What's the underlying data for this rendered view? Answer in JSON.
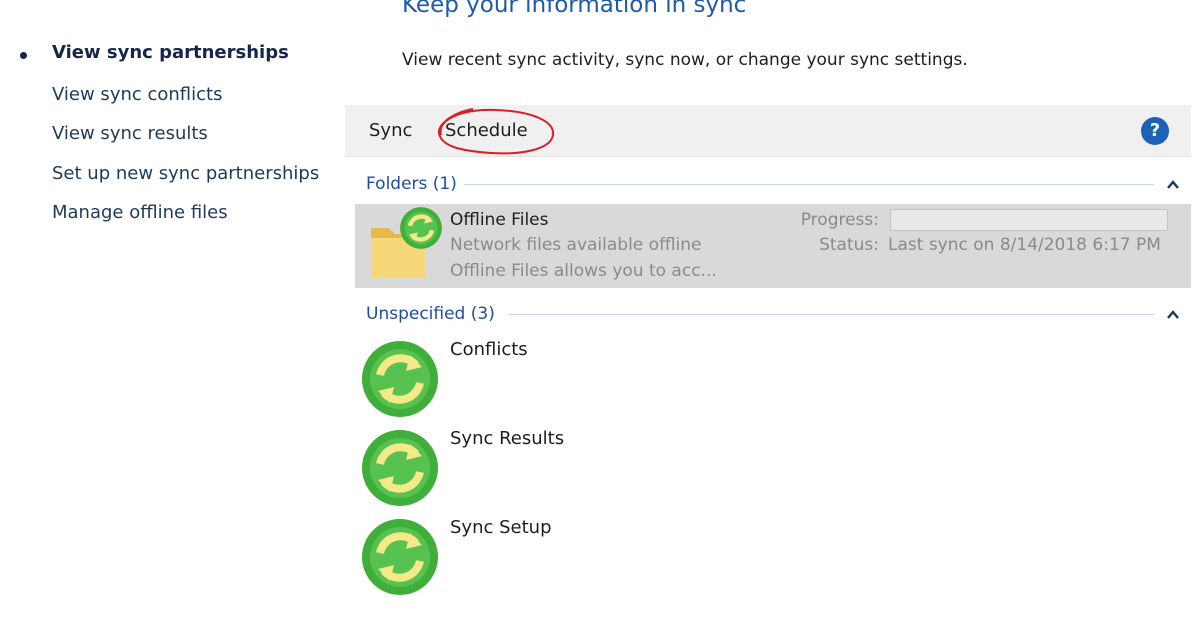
{
  "header": {
    "title": "Keep your information in sync",
    "description": "View recent sync activity, sync now, or change your sync settings."
  },
  "sidebar": {
    "items": [
      {
        "label": "View sync partnerships",
        "active": true
      },
      {
        "label": "View sync conflicts"
      },
      {
        "label": "View sync results"
      },
      {
        "label": "Set up new sync partnerships"
      },
      {
        "label": "Manage offline files"
      }
    ]
  },
  "toolbar": {
    "sync_label": "Sync",
    "schedule_label": "Schedule",
    "help_label": "?"
  },
  "groups": [
    {
      "header": "Folders (1)",
      "items": [
        {
          "title": "Offline Files",
          "subtitle1": "Network files available offline",
          "subtitle2": "Offline Files allows you to acc...",
          "progress_label": "Progress:",
          "status_label": "Status:",
          "status_value": "Last sync on 8/14/2018 6:17 PM",
          "progress": 0
        }
      ]
    },
    {
      "header": "Unspecified (3)",
      "items": [
        {
          "title": "Conflicts"
        },
        {
          "title": "Sync Results"
        },
        {
          "title": "Sync Setup"
        }
      ]
    }
  ],
  "colors": {
    "accent_blue": "#1e5aa8",
    "help_blue": "#1c62b9",
    "selection_gray": "#d9d9d9",
    "sync_green": "#3fae3a",
    "arrow_yellow": "#f4ea8a",
    "annotation_red": "#d81f2a"
  },
  "icons": [
    "sync-icon",
    "folder-icon",
    "help-icon",
    "chevron-up-icon"
  ]
}
